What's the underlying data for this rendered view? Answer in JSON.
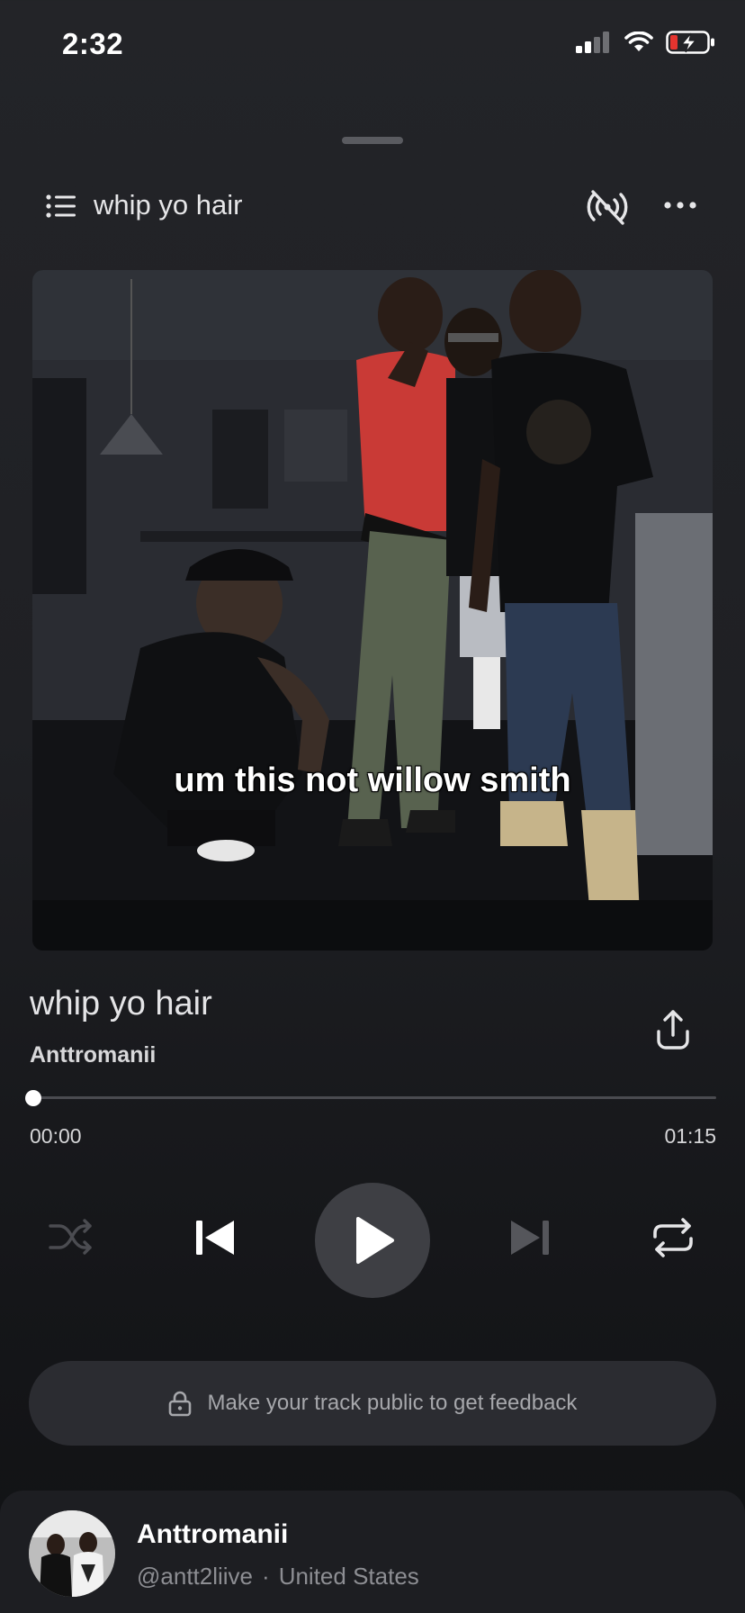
{
  "status_bar": {
    "time": "2:32"
  },
  "header": {
    "title": "whip yo hair"
  },
  "artwork": {
    "caption": "um this not willow smith"
  },
  "track": {
    "title": "whip yo hair",
    "artist": "Anttromanii"
  },
  "playback": {
    "elapsed": "00:00",
    "total": "01:15",
    "progress": 0.0,
    "state": "paused"
  },
  "feedback": {
    "text": "Make your track public to get feedback"
  },
  "profile": {
    "name": "Anttromanii",
    "handle": "@antt2liive",
    "separator": "·",
    "location": "United States"
  },
  "colors": {
    "background": "#1f2024",
    "play_button": "#3e3f44",
    "pill": "#2b2c31",
    "battery_low": "#e5342f"
  },
  "icons": [
    "signal-icon",
    "wifi-icon",
    "battery-icon",
    "queue-list-icon",
    "cast-off-icon",
    "more-icon",
    "share-icon",
    "shuffle-icon",
    "previous-icon",
    "play-icon",
    "next-icon",
    "repeat-icon",
    "lock-icon"
  ]
}
